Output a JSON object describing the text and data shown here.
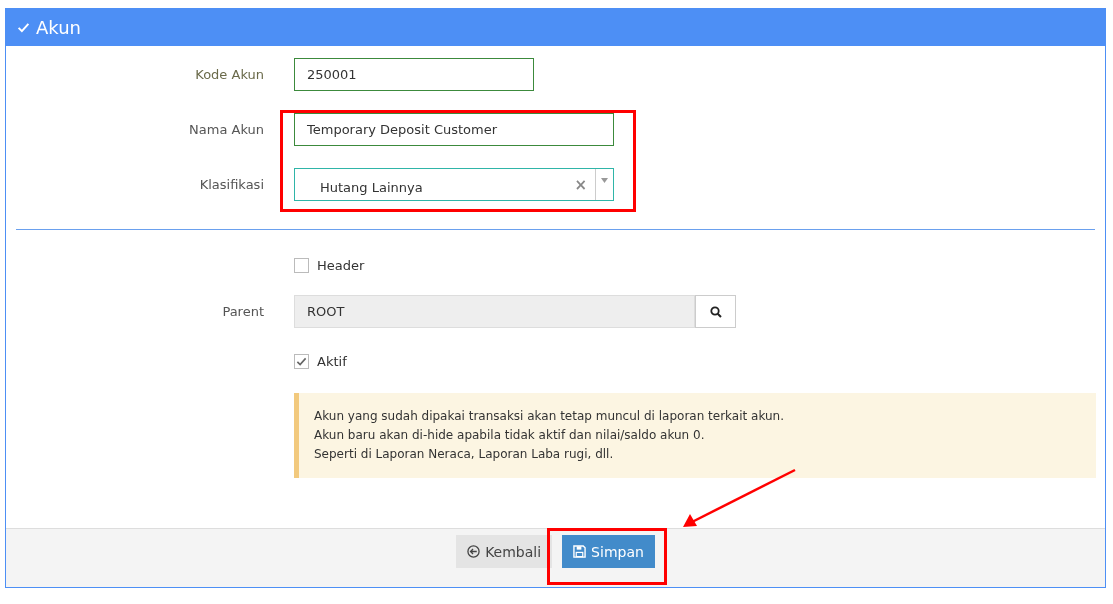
{
  "panel": {
    "title": "Akun"
  },
  "fields": [
    {
      "kind": "text",
      "label": "Kode Akun",
      "value": "250001"
    },
    {
      "kind": "text",
      "label": "Nama Akun",
      "value": "Temporary Deposit Customer"
    },
    {
      "kind": "select",
      "label": "Klasifikasi",
      "value": "Hutang Lainnya",
      "clear": "×"
    }
  ],
  "header_checkbox": {
    "label": "Header",
    "checked": false
  },
  "parent": {
    "label": "Parent",
    "value": "ROOT"
  },
  "aktif_checkbox": {
    "label": "Aktif",
    "checked": true
  },
  "notice": [
    "Akun yang sudah dipakai transaksi akan tetap muncul di laporan terkait akun.",
    "Akun baru akan di-hide apabila tidak aktif dan nilai/saldo akun 0.",
    "Seperti di Laporan Neraca, Laporan Laba rugi, dll."
  ],
  "buttons": [
    {
      "kind": "back",
      "label": "Kembali"
    },
    {
      "kind": "save",
      "label": "Simpan"
    }
  ]
}
